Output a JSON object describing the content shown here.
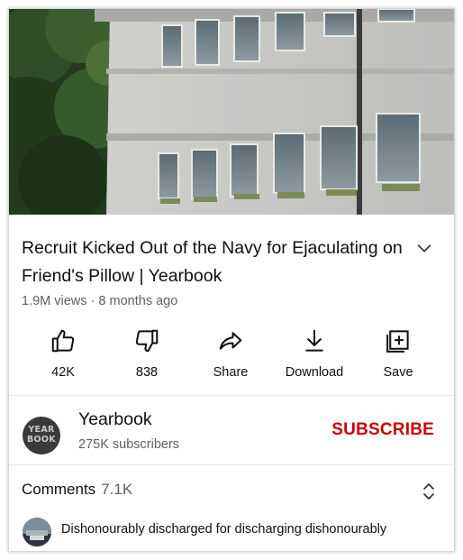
{
  "video": {
    "title": "Recruit Kicked Out of the Navy for Ejaculating on Friend's Pillow | Yearbook",
    "views": "1.9M views",
    "age": "8 months ago"
  },
  "actions": {
    "like_count": "42K",
    "dislike_count": "838",
    "share_label": "Share",
    "download_label": "Download",
    "save_label": "Save"
  },
  "channel": {
    "name": "Yearbook",
    "subscribers": "275K subscribers",
    "subscribe_label": "SUBSCRIBE",
    "avatar_text": [
      "YEAR",
      "BOOK"
    ]
  },
  "comments": {
    "label": "Comments",
    "count": "7.1K",
    "top_comment": "Dishonourably discharged for discharging dishonourably"
  },
  "colors": {
    "subscribe": "#cc0000",
    "secondary_text": "#606060",
    "divider": "#e5e5e5"
  },
  "icons": [
    "like-icon",
    "dislike-icon",
    "share-icon",
    "download-icon",
    "save-icon",
    "expand-chevron-icon",
    "comments-toggle-icon"
  ]
}
